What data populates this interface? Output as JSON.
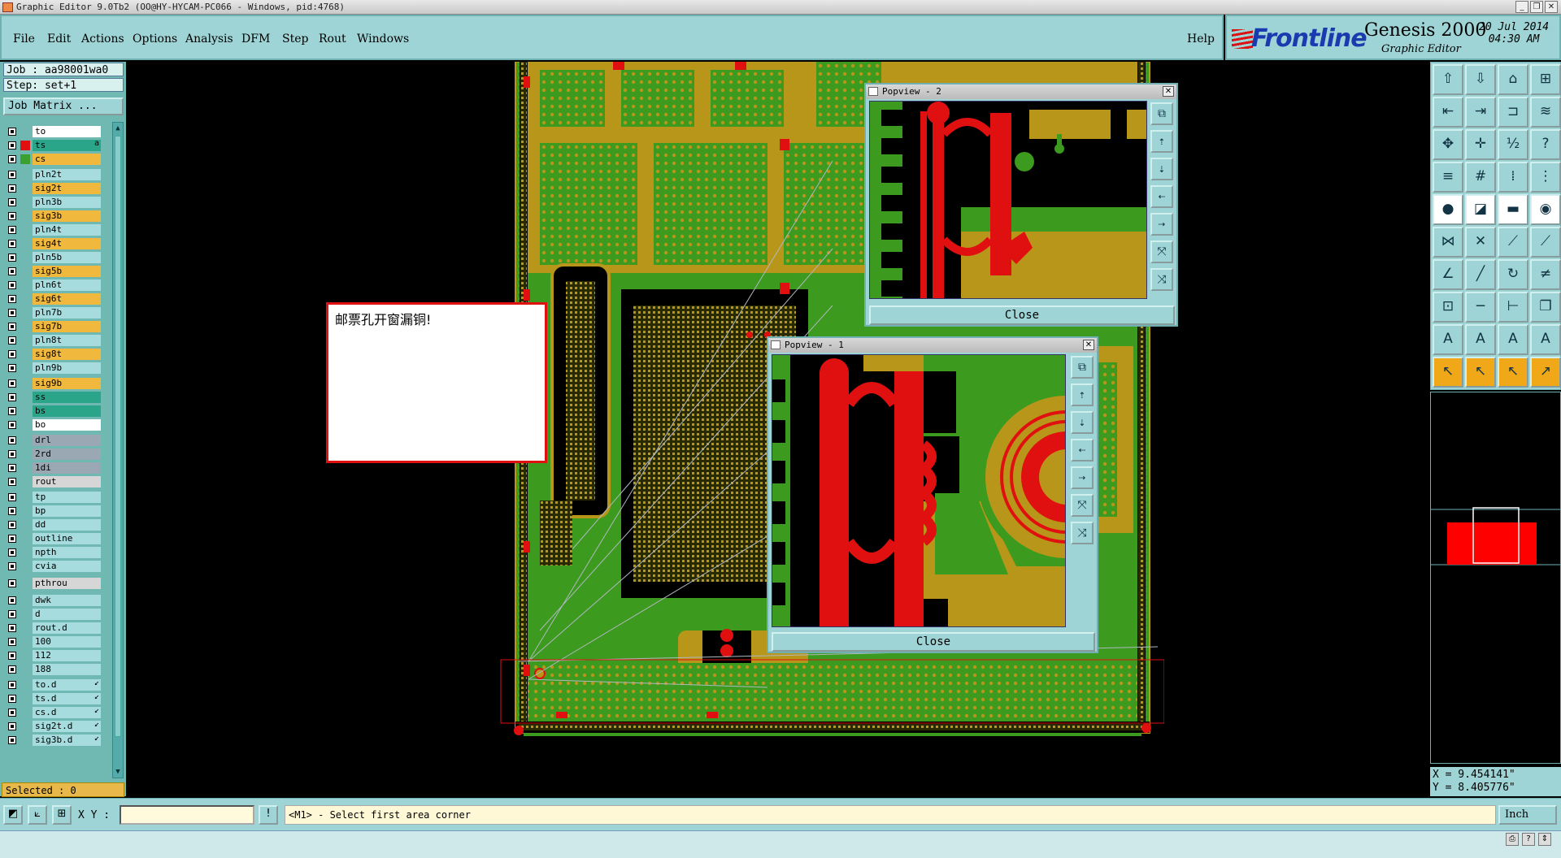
{
  "window": {
    "title": "Graphic Editor 9.0Tb2 (OO@HY-HYCAM-PC066 - Windows, pid:4768)"
  },
  "menu": [
    "File",
    "Edit",
    "Actions",
    "Options",
    "Analysis",
    "DFM",
    "Step",
    "Rout",
    "Windows"
  ],
  "help_label": "Help",
  "brand": {
    "logo": "Frontline",
    "product": "Genesis 2000",
    "subtitle": "Graphic Editor",
    "date": "20 Jul 2014",
    "time": "04:30 AM"
  },
  "job": {
    "job_label": "Job : aa98001wa0",
    "step_label": "Step: set+1",
    "matrix_button": "Job Matrix ..."
  },
  "layers": [
    {
      "name": "to",
      "color": "#ffffff",
      "swatch": ""
    },
    {
      "name": "ts",
      "color": "#2aa58a",
      "swatch": "#e01010",
      "mark": "a"
    },
    {
      "name": "cs",
      "color": "#f0b83c",
      "swatch": "#3aa030"
    },
    {
      "name": "pln2t",
      "color": "#a6dcde"
    },
    {
      "name": "sig2t",
      "color": "#f0b83c"
    },
    {
      "name": "pln3b",
      "color": "#a6dcde"
    },
    {
      "name": "sig3b",
      "color": "#f0b83c"
    },
    {
      "name": "pln4t",
      "color": "#a6dcde"
    },
    {
      "name": "sig4t",
      "color": "#f0b83c"
    },
    {
      "name": "pln5b",
      "color": "#a6dcde"
    },
    {
      "name": "sig5b",
      "color": "#f0b83c"
    },
    {
      "name": "pln6t",
      "color": "#a6dcde"
    },
    {
      "name": "sig6t",
      "color": "#f0b83c"
    },
    {
      "name": "pln7b",
      "color": "#a6dcde"
    },
    {
      "name": "sig7b",
      "color": "#f0b83c"
    },
    {
      "name": "pln8t",
      "color": "#a6dcde"
    },
    {
      "name": "sig8t",
      "color": "#f0b83c"
    },
    {
      "name": "pln9b",
      "color": "#a6dcde"
    },
    {
      "name": "sig9b",
      "color": "#f0b83c"
    },
    {
      "name": "ss",
      "color": "#2aa58a"
    },
    {
      "name": "bs",
      "color": "#2aa58a"
    },
    {
      "name": "bo",
      "color": "#ffffff"
    },
    {
      "name": "drl",
      "color": "#9aa8b4"
    },
    {
      "name": "2rd",
      "color": "#9aa8b4"
    },
    {
      "name": "1di",
      "color": "#9aa8b4"
    },
    {
      "name": "rout",
      "color": "#d6d6d6"
    },
    {
      "name": "tp",
      "color": "#a6dcde"
    },
    {
      "name": "bp",
      "color": "#a6dcde"
    },
    {
      "name": "dd",
      "color": "#a6dcde"
    },
    {
      "name": "outline",
      "color": "#a6dcde"
    },
    {
      "name": "npth",
      "color": "#a6dcde"
    },
    {
      "name": "cvia",
      "color": "#a6dcde"
    },
    {
      "name": "pthrou",
      "color": "#d6d6d6"
    },
    {
      "name": "dwk",
      "color": "#a6dcde"
    },
    {
      "name": "d",
      "color": "#a6dcde"
    },
    {
      "name": "rout.d",
      "color": "#a6dcde"
    },
    {
      "name": "100",
      "color": "#a6dcde"
    },
    {
      "name": "112",
      "color": "#a6dcde"
    },
    {
      "name": "188",
      "color": "#a6dcde"
    },
    {
      "name": "to.d",
      "color": "#a6dcde",
      "mark": "↙"
    },
    {
      "name": "ts.d",
      "color": "#a6dcde",
      "mark": "↙"
    },
    {
      "name": "cs.d",
      "color": "#a6dcde",
      "mark": "↙"
    },
    {
      "name": "sig2t.d",
      "color": "#a6dcde",
      "mark": "↙"
    },
    {
      "name": "sig3b.d",
      "color": "#a6dcde",
      "mark": "↙"
    }
  ],
  "selected_label": "Selected : 0",
  "note_text": "邮票孔开窗漏铜!",
  "popup2": {
    "title": "Popview - 2",
    "close_label": "Close"
  },
  "popup1": {
    "title": "Popview - 1",
    "close_label": "Close"
  },
  "coords": {
    "x": "X =  9.454141\"",
    "y": "Y =  8.405776\""
  },
  "bottom": {
    "xy_label": "X Y :",
    "xy_value": "",
    "prompt": "<M1> - Select first area corner",
    "units": "Inch"
  },
  "colors": {
    "panel": "#9ed4d6",
    "copper_green": "#3c9a1e",
    "copper_gold": "#b8961a",
    "highlight_red": "#ff0000"
  }
}
